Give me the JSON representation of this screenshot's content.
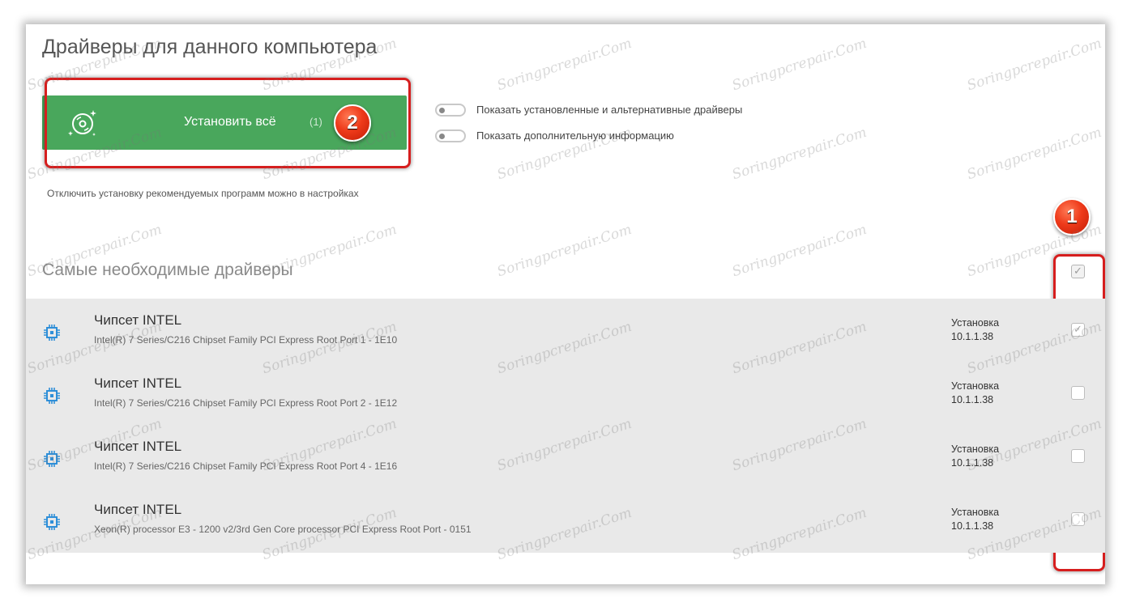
{
  "page": {
    "title": "Драйверы для данного компьютера"
  },
  "install": {
    "label": "Установить всё",
    "count": "(1)"
  },
  "options": {
    "show_installed_label": "Показать установленные и альтернативные драйверы",
    "show_more_info_label": "Показать дополнительную информацию"
  },
  "hint": "Отключить установку рекомендуемых программ можно в настройках",
  "section": {
    "title": "Самые необходимые драйверы"
  },
  "badges": {
    "one": "1",
    "two": "2"
  },
  "drivers": [
    {
      "name": "Чипсет INTEL",
      "description": "Intel(R) 7 Series/C216 Chipset Family PCI Express Root Port 1 - 1E10",
      "action": "Установка",
      "version": "10.1.1.38",
      "checked": true
    },
    {
      "name": "Чипсет INTEL",
      "description": "Intel(R) 7 Series/C216 Chipset Family PCI Express Root Port 2 - 1E12",
      "action": "Установка",
      "version": "10.1.1.38",
      "checked": false
    },
    {
      "name": "Чипсет INTEL",
      "description": "Intel(R) 7 Series/C216 Chipset Family PCI Express Root Port 4 - 1E16",
      "action": "Установка",
      "version": "10.1.1.38",
      "checked": false
    },
    {
      "name": "Чипсет INTEL",
      "description": "Xeon(R) processor E3 - 1200 v2/3rd Gen Core processor PCI Express Root Port - 0151",
      "action": "Установка",
      "version": "10.1.1.38",
      "checked": false
    }
  ],
  "watermark": "Soringpcrepair.Com",
  "colors": {
    "accent_green": "#49a75c",
    "highlight_red": "#d61e1e",
    "list_bg": "#e9e9e9",
    "chip_blue": "#2f8fd8"
  }
}
